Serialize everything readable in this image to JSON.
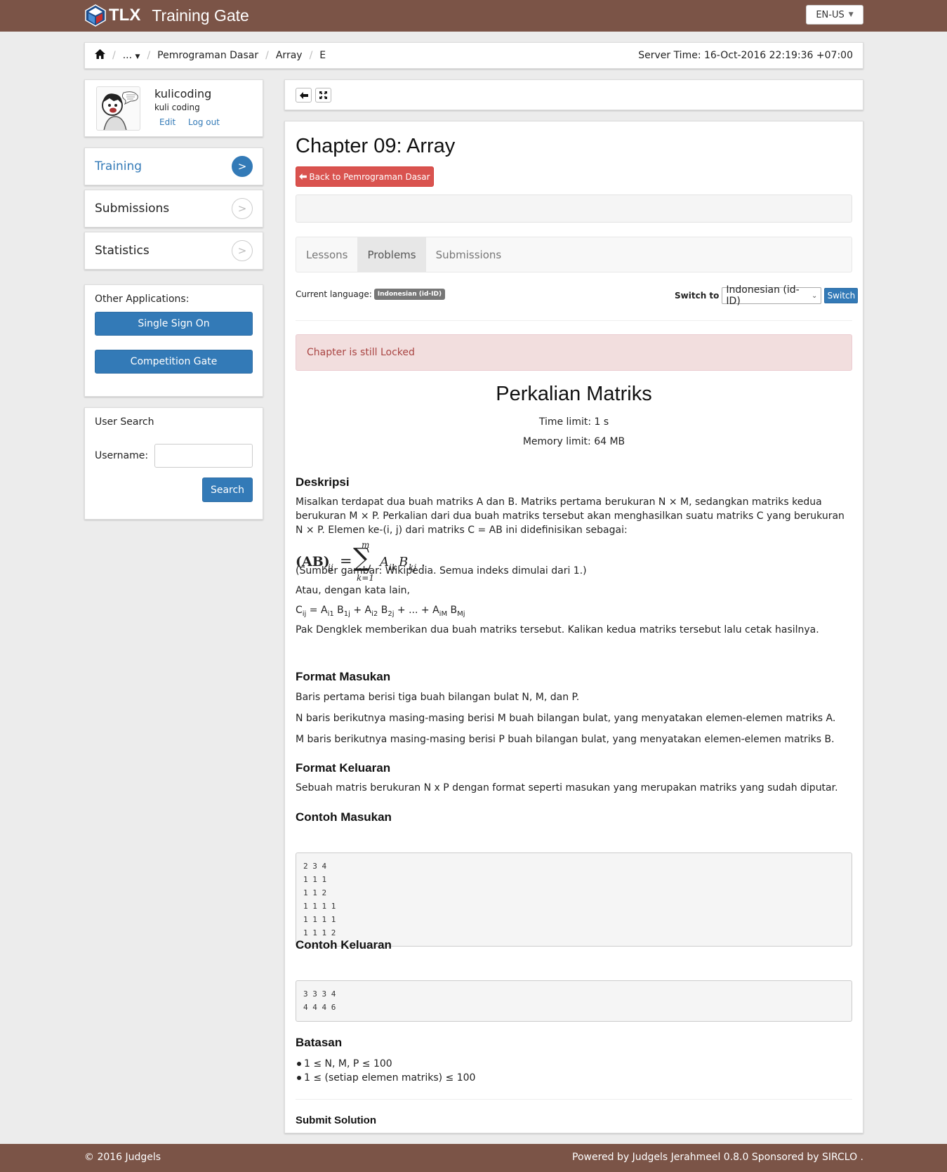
{
  "header": {
    "brand_short": "TLX",
    "brand_name": "Training Gate",
    "language": "EN-US"
  },
  "breadcrumb": {
    "items": [
      "...",
      "Pemrograman Dasar",
      "Array",
      "E"
    ],
    "server_time": "Server Time: 16-Oct-2016 22:19:36 +07:00"
  },
  "profile": {
    "username": "kulicoding",
    "realname": "kuli coding",
    "edit_label": "Edit",
    "logout_label": "Log out"
  },
  "sidebar": {
    "items": [
      {
        "label": "Training",
        "active": true
      },
      {
        "label": "Submissions",
        "active": false
      },
      {
        "label": "Statistics",
        "active": false
      }
    ],
    "nav_arrow": ">",
    "other_apps_title": "Other Applications:",
    "apps": [
      "Single Sign On",
      "Competition Gate"
    ],
    "user_search": {
      "title": "User Search",
      "username_label": "Username:",
      "username_value": "",
      "search_label": "Search"
    }
  },
  "main": {
    "chapter_title": "Chapter 09: Array",
    "back_label": "Back to Pemrograman Dasar",
    "tabs": [
      {
        "label": "Lessons",
        "active": false
      },
      {
        "label": "Problems",
        "active": true
      },
      {
        "label": "Submissions",
        "active": false
      }
    ],
    "current_language_label": "Current language:",
    "current_language_value": "Indonesian (id-ID)",
    "switch_to_label": "Switch to",
    "switch_select_value": "Indonesian (id-ID)",
    "switch_button": "Switch",
    "alert": "Chapter is still Locked"
  },
  "problem": {
    "title": "Perkalian Matriks",
    "time_limit": "Time limit: 1 s",
    "memory_limit": "Memory limit: 64 MB",
    "desc_heading": "Deskripsi",
    "desc_text": "Misalkan terdapat dua buah matriks A dan B. Matriks pertama berukuran N × M, sedangkan matriks kedua berukuran M × P. Perkalian dari dua buah matriks tersebut akan menghasilkan suatu matriks C yang berukuran N × P. Elemen ke-(i, j) dari matriks C = AB ini didefinisikan sebagai:",
    "formula": {
      "lhs": "(AB)",
      "lhs_sub": "ij",
      "sum_top": "m",
      "sum_bottom": "k=1",
      "term1": "A",
      "term1_sub": "ik",
      "term2": "B",
      "term2_sub": "kj"
    },
    "source_note": "(Sumber gambar: Wikipedia. Semua indeks dimulai dari 1.)",
    "in_other_words": "Atau, dengan kata lain,",
    "cij_formula": "Cij = Ai1 B1j + Ai2 B2j + ... + AiM BMj",
    "task": "Pak Dengklek memberikan dua buah matriks tersebut. Kalikan kedua matriks tersebut lalu cetak hasilnya.",
    "input_heading": "Format Masukan",
    "input_lines": [
      "Baris pertama berisi tiga buah bilangan bulat N, M, dan P.",
      "N baris berikutnya masing-masing berisi M buah bilangan bulat, yang menyatakan elemen-elemen matriks A.",
      "M baris berikutnya masing-masing berisi P buah bilangan bulat, yang menyatakan elemen-elemen matriks B."
    ],
    "output_heading": "Format Keluaran",
    "output_text": "Sebuah matris berukuran N x P dengan format seperti masukan yang merupakan matriks yang sudah diputar.",
    "sample_input_heading": "Contoh Masukan",
    "sample_input": "2 3 4\n1 1 1\n1 1 2\n1 1 1 1\n1 1 1 1\n1 1 1 2",
    "sample_output_heading": "Contoh Keluaran",
    "sample_output": "3 3 3 4\n4 4 4 6",
    "constraints_heading": "Batasan",
    "constraints": [
      "1 ≤ N, M, P ≤ 100",
      "1 ≤ (setiap elemen matriks) ≤ 100"
    ],
    "submit_heading": "Submit Solution"
  },
  "footer": {
    "copyright": "© 2016 Judgels",
    "powered": "Powered by Judgels Jerahmeel 0.8.0 Sponsored by SIRCLO ."
  },
  "colors": {
    "navbar": "#7b5447",
    "primary": "#337ab7",
    "danger": "#d9534f",
    "alert_bg": "#f2dede"
  }
}
